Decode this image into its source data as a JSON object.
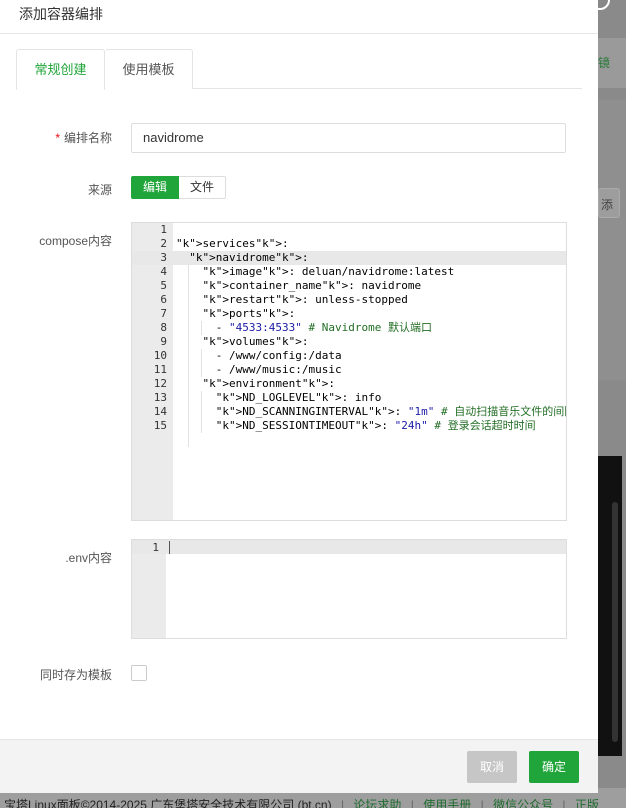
{
  "background": {
    "right_label": "镜",
    "right_button": "添",
    "footer": {
      "copyright": "宝塔Linux面板©2014-2025 广东堡塔安全技术有限公司 (bt.cn)",
      "forum": "论坛求助",
      "manual": "使用手册",
      "wechat": "微信公众号",
      "more": "正版"
    }
  },
  "dialog": {
    "title": "添加容器编排",
    "tabs": [
      {
        "label": "常规创建",
        "active": true
      },
      {
        "label": "使用模板",
        "active": false
      }
    ],
    "form": {
      "name_label": "编排名称",
      "name_required": "*",
      "name_value": "navidrome",
      "source_label": "来源",
      "source_options": [
        "编辑",
        "文件"
      ],
      "source_selected": "编辑",
      "compose_label": "compose内容",
      "env_label": ".env内容",
      "save_template_label": "同时存为模板",
      "save_template_checked": false
    },
    "compose_lines": [
      {
        "n": "1",
        "text": ""
      },
      {
        "n": "2",
        "text": "services:"
      },
      {
        "n": "3",
        "text": "  navidrome:"
      },
      {
        "n": "4",
        "text": "    image: deluan/navidrome:latest"
      },
      {
        "n": "5",
        "text": "    container_name: navidrome"
      },
      {
        "n": "6",
        "text": "    restart: unless-stopped"
      },
      {
        "n": "7",
        "text": "    ports:"
      },
      {
        "n": "8",
        "text": "      - \"4533:4533\" # Navidrome 默认端口"
      },
      {
        "n": "9",
        "text": "    volumes:"
      },
      {
        "n": "10",
        "text": "      - /www/config:/data"
      },
      {
        "n": "11",
        "text": "      - /www/music:/music"
      },
      {
        "n": "12",
        "text": "    environment:"
      },
      {
        "n": "13",
        "text": "      ND_LOGLEVEL: info"
      },
      {
        "n": "14",
        "text": "      ND_SCANNINGINTERVAL: \"1m\" # 自动扫描音乐文件的间隔"
      },
      {
        "n": "15",
        "text": "      ND_SESSIONTIMEOUT: \"24h\" # 登录会话超时时间"
      }
    ],
    "env_lines": [
      {
        "n": "1",
        "text": ""
      }
    ],
    "footer": {
      "cancel_label": "取消",
      "confirm_label": "确定"
    },
    "colors": {
      "accent": "#20a53a",
      "cancel": "#c6c6c6",
      "required": "#ef0808"
    }
  }
}
